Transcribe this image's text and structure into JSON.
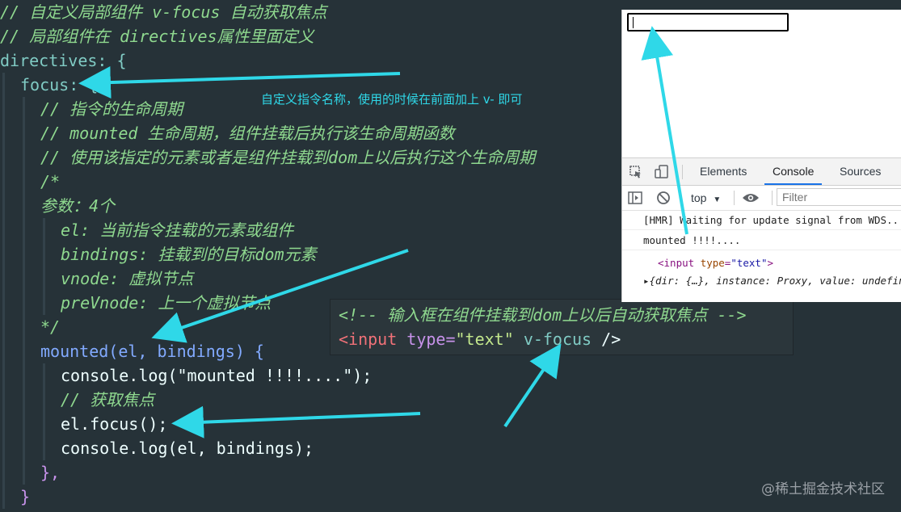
{
  "code_lines": [
    "// 自定义局部组件 v-focus 自动获取焦点",
    "// 局部组件在 directives属性里面定义",
    "directives: {",
    "focus: {",
    "// 指令的生命周期",
    "// mounted 生命周期，组件挂载后执行该生命周期函数",
    "// 使用该指定的元素或者是组件挂载到dom上以后执行这个生命周期",
    "/*",
    "参数：4个",
    "el: 当前指令挂载的元素或组件",
    "bindings: 挂载到的目标dom元素",
    "vnode: 虚拟节点",
    "preVnode: 上一个虚拟节点",
    "*/",
    "mounted(el, bindings) {",
    "console.log(\"mounted !!!!....\");",
    "// 获取焦点",
    "el.focus();",
    "console.log(el, bindings);",
    "},",
    "}"
  ],
  "snippet": {
    "comment": "<!-- 输入框在组件挂载到dom上以后自动获取焦点 -->",
    "tag_open": "<input",
    "attr_type": "type=",
    "attr_type_value": "\"text\"",
    "attr_directive": "v-focus",
    "tag_close": "/>"
  },
  "annotation": "自定义指令名称，使用的时候在前面加上 v- 即可",
  "devtools": {
    "tabs": [
      "Elements",
      "Console",
      "Sources"
    ],
    "active_tab": "Console",
    "context": "top",
    "filter_placeholder": "Filter",
    "console_lines": [
      "[HMR] Waiting for update signal from WDS...",
      "mounted !!!!...."
    ],
    "element_line": {
      "tag_open": "<input",
      "attr": "type",
      "value": "\"text\"",
      "tag_close": ">"
    },
    "object_line": "▸{dir: {…}, instance: Proxy, value: undefined"
  },
  "watermark": "@稀土掘金技术社区",
  "colors": {
    "editor_bg": "#263238",
    "comment": "#8fd98f",
    "arrow": "#2fd8e8"
  }
}
